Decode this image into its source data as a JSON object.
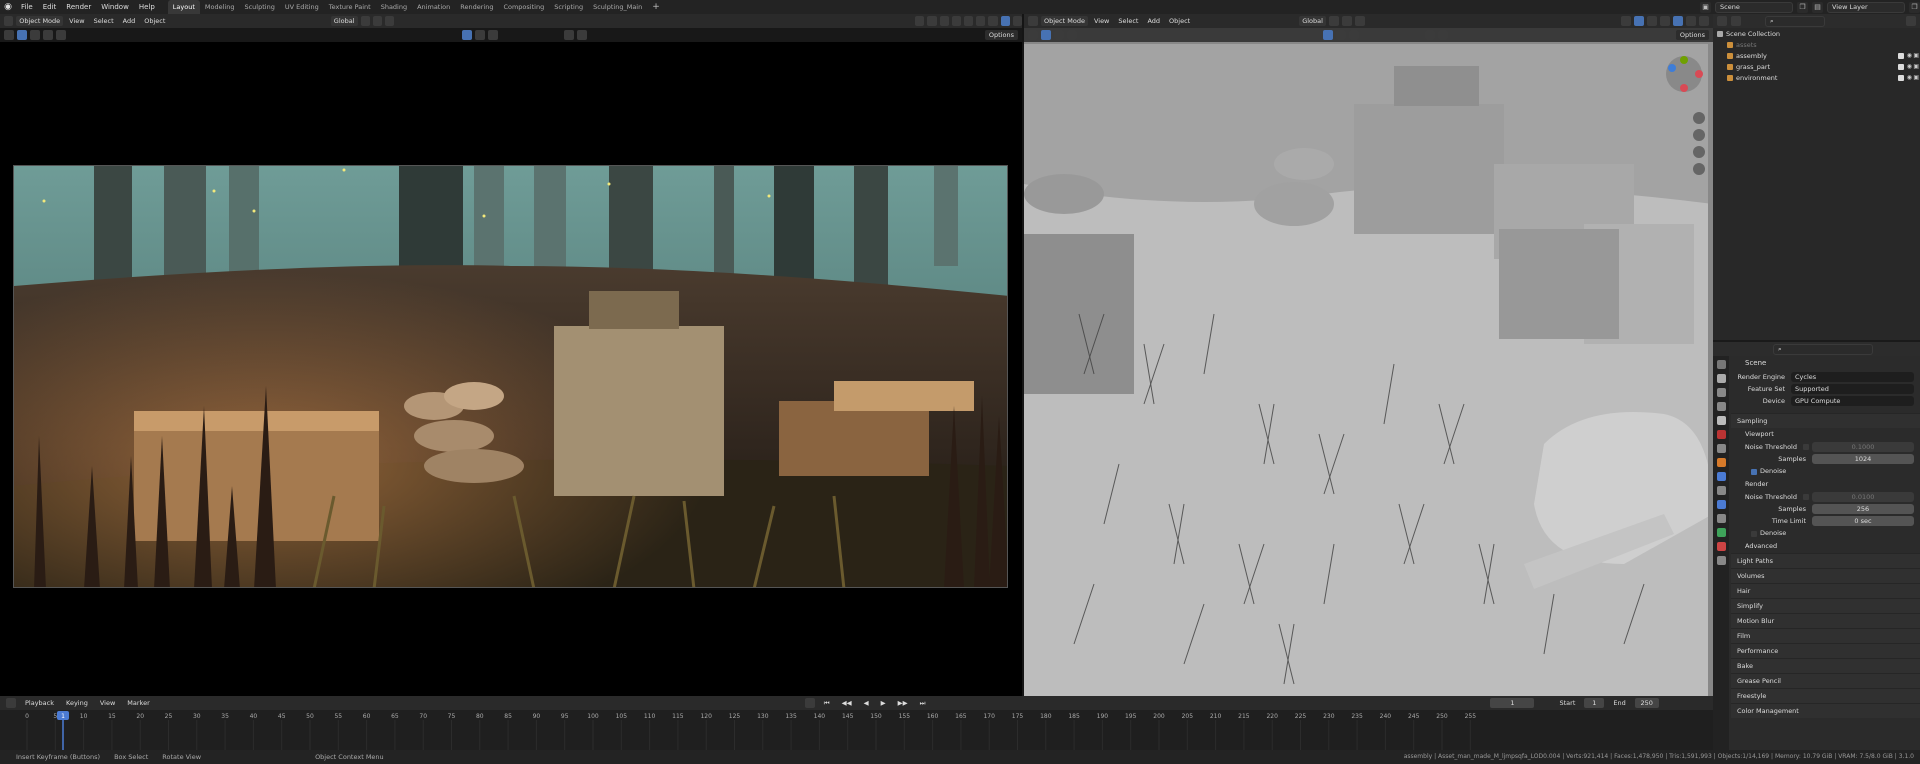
{
  "menu": [
    "File",
    "Edit",
    "Render",
    "Window",
    "Help"
  ],
  "workspace_tabs": [
    "Layout",
    "Modeling",
    "Sculpting",
    "UV Editing",
    "Texture Paint",
    "Shading",
    "Animation",
    "Rendering",
    "Compositing",
    "Scripting",
    "Sculpting_Main"
  ],
  "active_tab": "Layout",
  "scene_name": "Scene",
  "view_layer": "View Layer",
  "left_viewport": {
    "mode": "Object Mode",
    "menus": [
      "View",
      "Select",
      "Add",
      "Object"
    ],
    "orientation": "Global",
    "options": "Options"
  },
  "right_viewport": {
    "mode": "Object Mode",
    "menus": [
      "View",
      "Select",
      "Add",
      "Object"
    ],
    "orientation": "Global",
    "options": "Options"
  },
  "outliner": {
    "root": "Scene Collection",
    "items": [
      "assets",
      "assembly",
      "grass_part",
      "environment"
    ]
  },
  "properties": {
    "scene": "Scene",
    "render_engine_label": "Render Engine",
    "render_engine": "Cycles",
    "feature_set_label": "Feature Set",
    "feature_set": "Supported",
    "device_label": "Device",
    "device": "GPU Compute",
    "sampling": "Sampling",
    "viewport": "Viewport",
    "noise_threshold_label": "Noise Threshold",
    "viewport_noise_threshold": "0.1000",
    "samples_label": "Samples",
    "viewport_samples": "1024",
    "denoise": "Denoise",
    "render": "Render",
    "render_noise_threshold": "0.0100",
    "render_samples": "256",
    "time_limit_label": "Time Limit",
    "time_limit": "0 sec",
    "advanced": "Advanced",
    "sections": [
      "Light Paths",
      "Volumes",
      "Hair",
      "Simplify",
      "Motion Blur",
      "Film",
      "Performance",
      "Bake",
      "Grease Pencil",
      "Freestyle",
      "Color Management"
    ]
  },
  "timeline": {
    "menus": [
      "Playback",
      "Keying",
      "View",
      "Marker"
    ],
    "current_frame": "1",
    "start_label": "Start",
    "start": "1",
    "end_label": "End",
    "end": "250",
    "ruler": [
      "0",
      "5",
      "10",
      "15",
      "20",
      "25",
      "30",
      "35",
      "40",
      "45",
      "50",
      "55",
      "60",
      "65",
      "70",
      "75",
      "80",
      "85",
      "90",
      "95",
      "100",
      "105",
      "110",
      "115",
      "120",
      "125",
      "130",
      "135",
      "140",
      "145",
      "150",
      "155",
      "160",
      "165",
      "170",
      "175",
      "180",
      "185",
      "190",
      "195",
      "200",
      "205",
      "210",
      "215",
      "220",
      "225",
      "230",
      "235",
      "240",
      "245",
      "250",
      "255"
    ],
    "playhead_label": "1"
  },
  "status": {
    "hints": [
      "Insert Keyframe (Buttons)",
      "Box Select",
      "Rotate View",
      "Object Context Menu"
    ],
    "stats": "assembly | Asset_man_made_M_ljmpsqfa_LOD0.004 | Verts:921,414 | Faces:1,478,950 | Tris:1,591,993 | Objects:1/14,169 | Memory: 10.79 GiB | VRAM: 7.5/8.0 GiB | 3.1.0"
  }
}
